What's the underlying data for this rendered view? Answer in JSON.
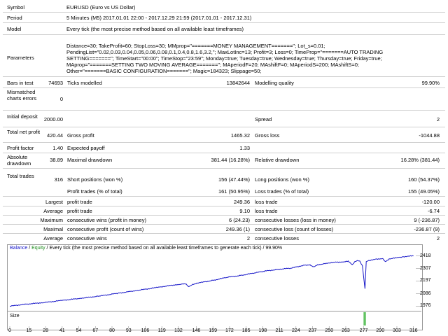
{
  "labels": {
    "symbol": "Symbol",
    "period": "Period",
    "model": "Model",
    "parameters": "Parameters",
    "bars_in_test": "Bars in test",
    "ticks_modelled": "Ticks modelled",
    "modelling_quality": "Modelling quality",
    "mismatched": "Mismatched charts errors",
    "initial_deposit": "Initial deposit",
    "spread": "Spread",
    "total_net_profit": "Total net profit",
    "gross_profit": "Gross profit",
    "gross_loss": "Gross loss",
    "profit_factor": "Profit factor",
    "expected_payoff": "Expected payoff",
    "absolute_drawdown": "Absolute drawdown",
    "maximal_drawdown": "Maximal drawdown",
    "relative_drawdown": "Relative drawdown",
    "total_trades": "Total trades",
    "short_positions": "Short positions (won %)",
    "long_positions": "Long positions (won %)",
    "profit_trades": "Profit trades (% of total)",
    "loss_trades": "Loss trades (% of total)",
    "largest": "Largest",
    "average": "Average",
    "maximum": "Maximum",
    "maximal": "Maximal",
    "profit_trade": "profit trade",
    "loss_trade": "loss trade",
    "cons_wins_money": "consecutive wins (profit in money)",
    "cons_losses_money": "consecutive losses (loss in money)",
    "cons_profit_count": "consecutive profit (count of wins)",
    "cons_loss_count": "consecutive loss (count of losses)",
    "cons_wins": "consecutive wins",
    "cons_losses": "consecutive losses"
  },
  "values": {
    "symbol": "EURUSD (Euro vs US Dollar)",
    "period": "5 Minutes (M5) 2017.01.01 22:00 - 2017.12.29 21:59 (2017.01.01 - 2017.12.31)",
    "model": "Every tick (the most precise method based on all available least timeframes)",
    "parameters": [
      "Distance=30; TakeProfit=60; StopLoss=30; MMprop=\"=======MONEY MANAGEMENT=======\"; Lot_s=0.01;",
      "PendingList=\"0.02,0.03,0.04,0.05,0.06,0.08,0.1,0.4,0.8,1.6,3.2,\"; MaxLotInc=13; Profit=3; Loss=0; TimeProp=\"=======AUTO TRADING",
      "SETTING=======\"; TimeStart=\"00:00\"; TimeStop=\"23:59\"; Monday=true; Tuesday=true; Wednesday=true; Thursday=true; Friday=true;",
      "MAprop=\"=======SETTING TWO MOVING AVERAGE=======\"; MAperiodF=20; MAshiftF=0; MAperiodS=200; MAshiftS=0;",
      "Other=\"=======BASIC CONFIGURATION=======\"; Magic=184323; Slippage=50;"
    ],
    "bars_in_test": "74693",
    "ticks_modelled": "13842644",
    "modelling_quality": "99.90%",
    "mismatched": "0",
    "initial_deposit": "2000.00",
    "spread": "2",
    "total_net_profit": "420.44",
    "gross_profit": "1465.32",
    "gross_loss": "-1044.88",
    "profit_factor": "1.40",
    "expected_payoff": "1.33",
    "absolute_drawdown": "38.89",
    "maximal_drawdown": "381.44 (16.28%)",
    "relative_drawdown": "16.28% (381.44)",
    "total_trades": "316",
    "short_positions": "156 (47.44%)",
    "long_positions": "160 (54.37%)",
    "profit_trades": "161 (50.95%)",
    "loss_trades": "155 (49.05%)",
    "largest_profit": "249.36",
    "largest_loss": "-120.00",
    "average_profit": "9.10",
    "average_loss": "-6.74",
    "max_cons_wins_money": "6 (24.23)",
    "max_cons_losses_money": "9 (-236.87)",
    "max_cons_profit_count": "249.36 (1)",
    "max_cons_loss_count": "-236.87 (9)",
    "avg_cons_wins": "2",
    "avg_cons_losses": "2"
  },
  "colors": {
    "balance": "#1515c8",
    "equity": "#1a8a1a",
    "volume": "#22aa22"
  },
  "chart_data": {
    "type": "line",
    "legend_text": {
      "balance": "Balance",
      "sep": " / ",
      "equity": "Equity",
      "rest": " / Every tick (the most precise method based on all available least timeframes to generate each tick) / 99.90%"
    },
    "size_label": "Size",
    "yticks": [
      2418,
      2307,
      2197,
      2086,
      1976
    ],
    "ylim": [
      1960,
      2440
    ],
    "xticks": [
      0,
      15,
      28,
      41,
      54,
      67,
      80,
      93,
      106,
      119,
      132,
      146,
      159,
      172,
      185,
      198,
      211,
      224,
      237,
      250,
      263,
      277,
      290,
      303,
      316
    ],
    "xlim": [
      0,
      320
    ],
    "series": [
      {
        "x": [
          0,
          12,
          25,
          40,
          55,
          70,
          85,
          100,
          115,
          130,
          138,
          140,
          143,
          150,
          160,
          170,
          180,
          190,
          200,
          210,
          220,
          230,
          235,
          238,
          241,
          250,
          255,
          260,
          265,
          268,
          270,
          272,
          274,
          276,
          277,
          278,
          279,
          281,
          283,
          287,
          292,
          294,
          297,
          302,
          308,
          312,
          316
        ],
        "y": [
          1976,
          1993,
          2006,
          2025,
          2045,
          2065,
          2090,
          2115,
          2140,
          2165,
          2172,
          2145,
          2168,
          2185,
          2205,
          2230,
          2245,
          2265,
          2285,
          2300,
          2310,
          2335,
          2340,
          2320,
          2340,
          2355,
          2362,
          2365,
          2370,
          2340,
          2368,
          2375,
          2372,
          2330,
          2230,
          2130,
          2365,
          2378,
          2380,
          2390,
          2395,
          2365,
          2392,
          2400,
          2410,
          2416,
          2418
        ]
      }
    ],
    "volume": {
      "x": [
        277,
        278
      ],
      "values": [
        1,
        1
      ]
    }
  }
}
